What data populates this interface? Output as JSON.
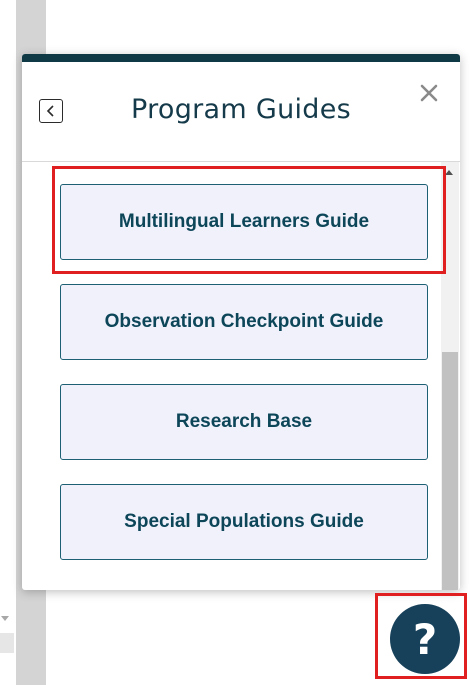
{
  "panel": {
    "title": "Program Guides",
    "back_icon": "chevron-left-icon",
    "close_icon": "close-icon",
    "close_glyph": "✕"
  },
  "guides": [
    {
      "label": "Multilingual Learners Guide"
    },
    {
      "label": "Observation Checkpoint Guide"
    },
    {
      "label": "Research Base"
    },
    {
      "label": "Special Populations Guide"
    }
  ],
  "help": {
    "icon": "question-mark-icon",
    "glyph": "?"
  },
  "colors": {
    "accent_bar": "#0f3a45",
    "title_text": "#153a4a",
    "button_bg": "#f0f1fb",
    "button_border": "#1d5f73",
    "button_text": "#0d4659",
    "highlight": "#e02020",
    "help_bg": "#17415a"
  }
}
